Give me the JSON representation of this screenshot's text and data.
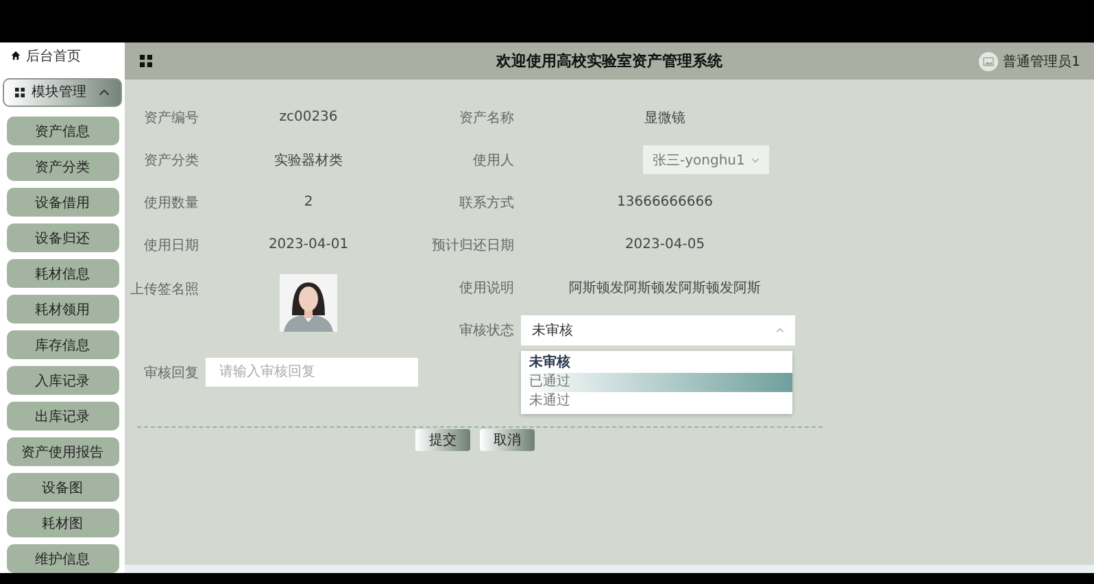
{
  "sidebar": {
    "home": "后台首页",
    "group": {
      "label": "模块管理",
      "expanded": true
    },
    "items": [
      {
        "label": "资产信息"
      },
      {
        "label": "资产分类"
      },
      {
        "label": "设备借用"
      },
      {
        "label": "设备归还"
      },
      {
        "label": "耗材信息"
      },
      {
        "label": "耗材领用"
      },
      {
        "label": "库存信息"
      },
      {
        "label": "入库记录"
      },
      {
        "label": "出库记录"
      },
      {
        "label": "资产使用报告"
      },
      {
        "label": "设备图"
      },
      {
        "label": "耗材图"
      },
      {
        "label": "维护信息"
      }
    ]
  },
  "header": {
    "title": "欢迎使用高校实验室资产管理系统",
    "user": "普通管理员1"
  },
  "form": {
    "fields": [
      {
        "kind": "text",
        "label": "资产编号",
        "value": "zc00236"
      },
      {
        "kind": "text",
        "label": "资产名称",
        "value": "显微镜"
      },
      {
        "kind": "text",
        "label": "资产分类",
        "value": "实验器材类"
      },
      {
        "kind": "select",
        "label": "使用人",
        "value": "张三-yonghu1"
      },
      {
        "kind": "text",
        "label": "使用数量",
        "value": "2"
      },
      {
        "kind": "text",
        "label": "联系方式",
        "value": "13666666666"
      },
      {
        "kind": "text",
        "label": "使用日期",
        "value": "2023-04-01"
      },
      {
        "kind": "text",
        "label": "预计归还日期",
        "value": "2023-04-05"
      },
      {
        "label": "上传签名照"
      },
      {
        "kind": "text",
        "label": "使用说明",
        "value": "阿斯顿发阿斯顿发阿斯顿发阿斯"
      },
      {
        "kind": "status",
        "label": "审核状态",
        "value": "未审核",
        "expanded": true,
        "options": [
          {
            "label": "未审核",
            "selected": true,
            "hovered": false
          },
          {
            "label": "已通过",
            "selected": false,
            "hovered": true
          },
          {
            "label": "未通过",
            "selected": false,
            "hovered": false
          }
        ]
      },
      {
        "kind": "input",
        "label": "审核回复",
        "placeholder": "请输入审核回复"
      }
    ],
    "buttons": [
      "提交",
      "取消"
    ]
  }
}
